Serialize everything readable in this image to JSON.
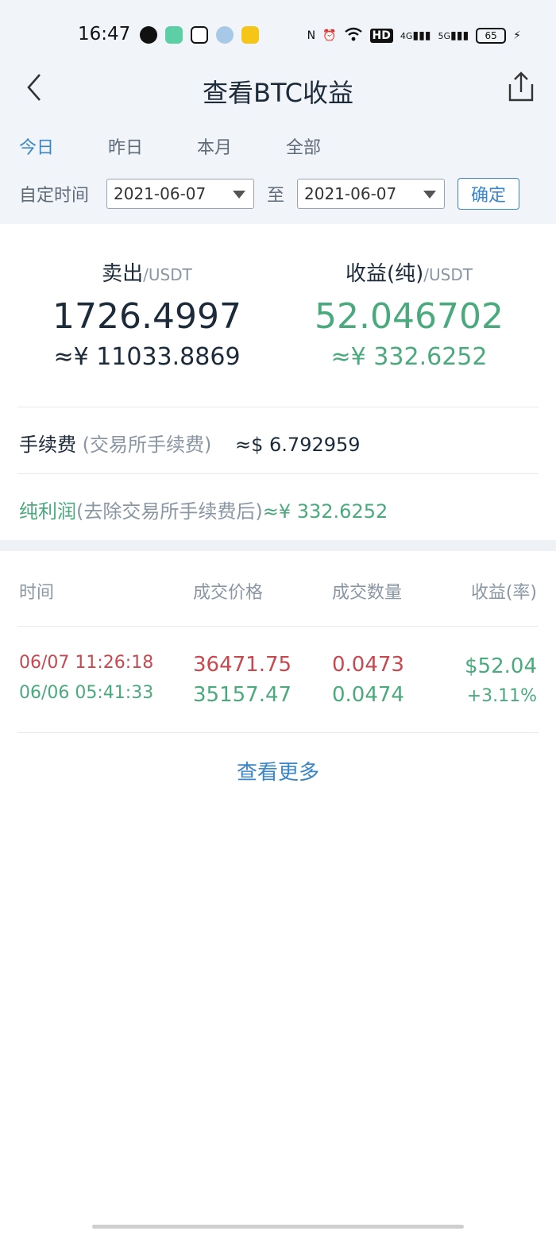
{
  "status_bar": {
    "time": "16:47",
    "network_labels": [
      "HD",
      "4G",
      "5G"
    ],
    "battery": "65"
  },
  "nav": {
    "title": "查看BTC收益",
    "back_icon": "chevron-left-icon",
    "share_icon": "share-icon"
  },
  "tabs": [
    {
      "label": "今日",
      "active": true
    },
    {
      "label": "昨日",
      "active": false
    },
    {
      "label": "本月",
      "active": false
    },
    {
      "label": "全部",
      "active": false
    }
  ],
  "date_filter": {
    "label": "自定时间",
    "start": "2021-06-07",
    "to_label": "至",
    "end": "2021-06-07",
    "confirm": "确定"
  },
  "summary": {
    "sell": {
      "title": "卖出",
      "unit": "/USDT",
      "value": "1726.4997",
      "cny": "≈¥ 11033.8869"
    },
    "profit": {
      "title": "收益(纯)",
      "unit": "/USDT",
      "value": "52.046702",
      "cny": "≈¥ 332.6252"
    }
  },
  "fee": {
    "label": "手续费",
    "sub": "(交易所手续费)",
    "value": "≈$ 6.792959"
  },
  "net_profit": {
    "label": "纯利润",
    "sub": "(去除交易所手续费后)",
    "value": "≈¥ 332.6252"
  },
  "table": {
    "headers": [
      "时间",
      "成交价格",
      "成交数量",
      "收益(率)"
    ],
    "sell_row": {
      "time": "06/07 11:26:18",
      "price": "36471.75",
      "qty": "0.0473",
      "profit": "$52.04"
    },
    "buy_row": {
      "time": "06/06 05:41:33",
      "price": "35157.47",
      "qty": "0.0474",
      "rate": "+3.11%"
    }
  },
  "more": "查看更多",
  "colors": {
    "accent": "#3a86c8",
    "green": "#4aaa7e",
    "red": "#c8484f"
  }
}
